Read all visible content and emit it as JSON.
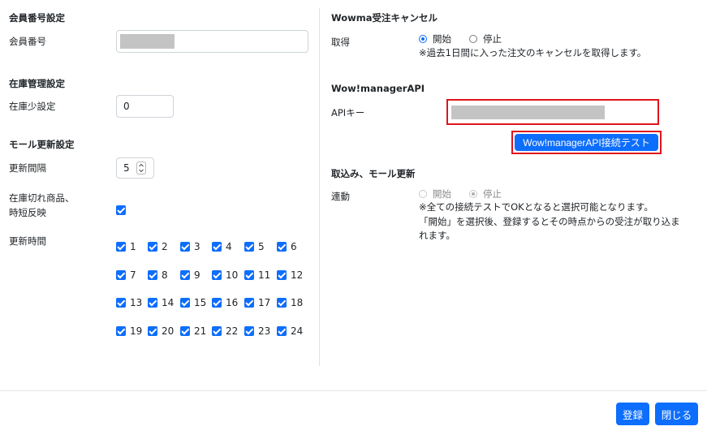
{
  "left": {
    "member": {
      "heading": "会員番号設定",
      "label": "会員番号"
    },
    "stock": {
      "heading": "在庫管理設定",
      "label": "在庫少設定",
      "value": "0"
    },
    "mall": {
      "heading": "モール更新設定",
      "interval_label": "更新間隔",
      "interval_value": "5",
      "soldout_label_line1": "在庫切れ商品、",
      "soldout_label_line2": "時短反映",
      "hours_label": "更新時間",
      "hours": [
        "1",
        "2",
        "3",
        "4",
        "5",
        "6",
        "7",
        "8",
        "9",
        "10",
        "11",
        "12",
        "13",
        "14",
        "15",
        "16",
        "17",
        "18",
        "19",
        "20",
        "21",
        "22",
        "23",
        "24"
      ]
    }
  },
  "right": {
    "cancel": {
      "heading": "Wowma受注キャンセル",
      "label": "取得",
      "option_start": "開始",
      "option_stop": "停止",
      "note": "※過去1日間に入った注文のキャンセルを取得します。"
    },
    "api": {
      "heading": "Wow!managerAPI",
      "label": "APIキー",
      "test_button": "Wow!managerAPI接続テスト"
    },
    "import": {
      "heading": "取込み、モール更新",
      "label": "連動",
      "option_start": "開始",
      "option_stop": "停止",
      "note1": "※全ての接続テストでOKとなると選択可能となります。",
      "note2": "「開始」を選択後、登録するとその時点からの受注が取り込ま",
      "note3": "れます。"
    }
  },
  "footer": {
    "register": "登録",
    "close": "閉じる"
  },
  "colors": {
    "primary": "#0d6efd",
    "highlight": "#e0141c",
    "masked": "#c4c4c4"
  }
}
